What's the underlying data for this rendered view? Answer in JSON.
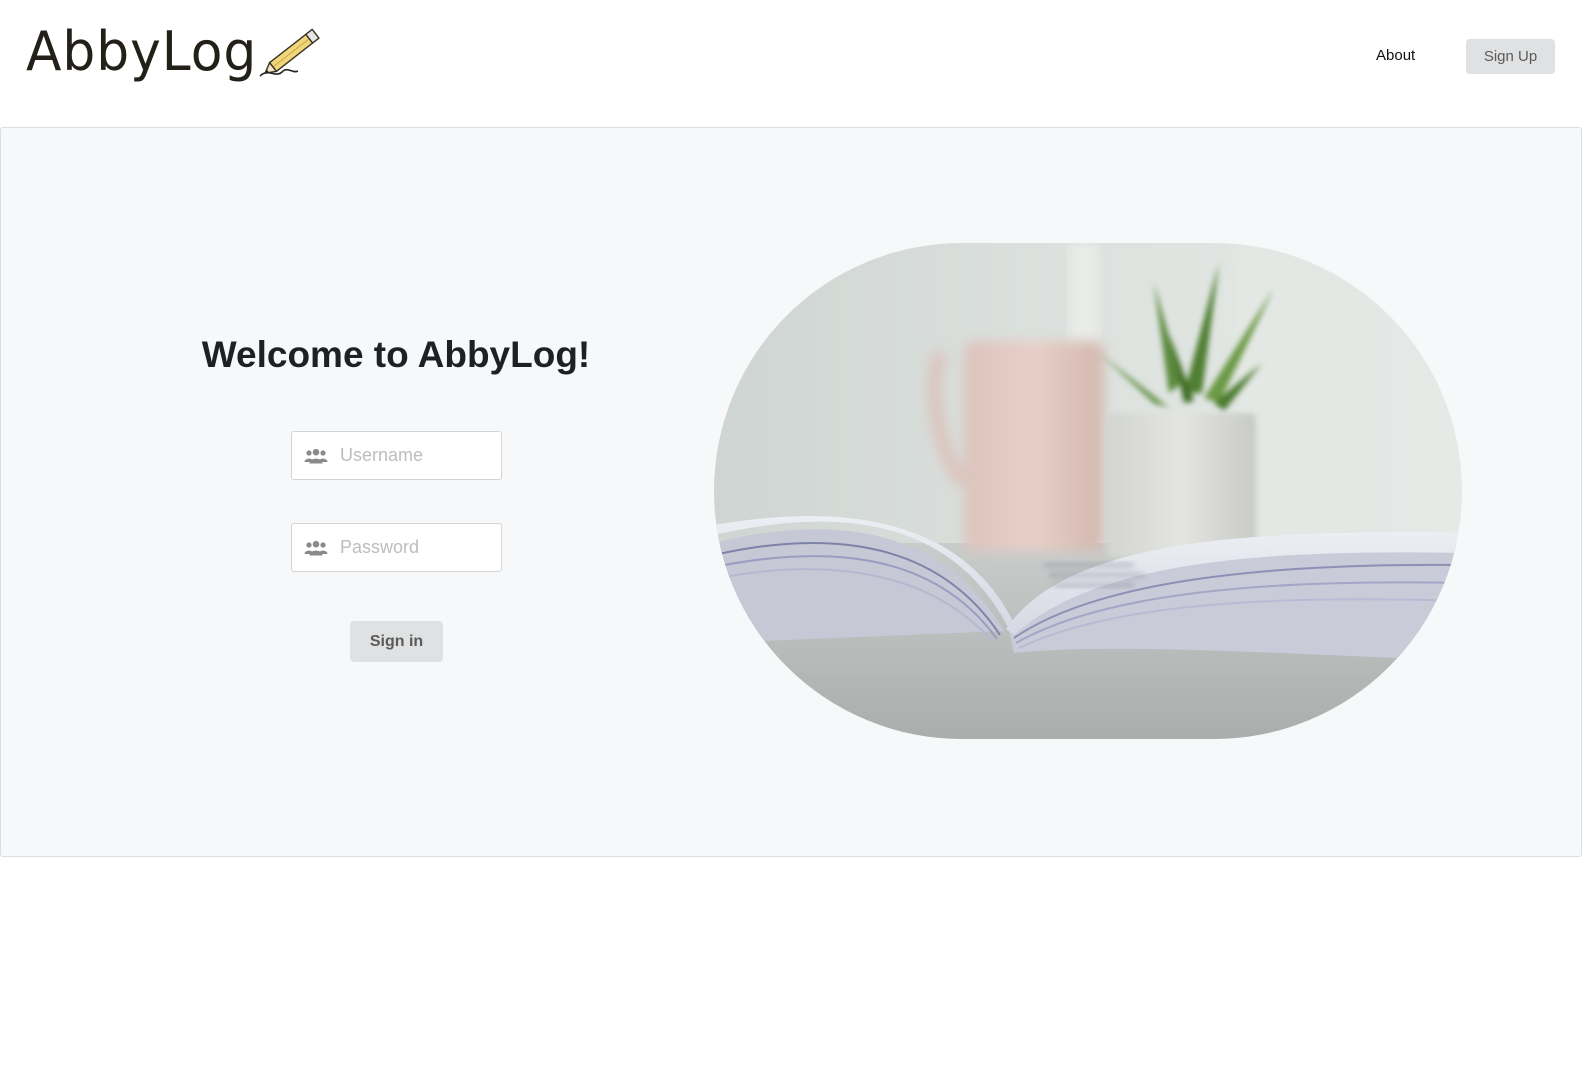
{
  "header": {
    "logo_text": "AbbyLog",
    "nav": {
      "about_label": "About",
      "signup_label": "Sign Up"
    }
  },
  "login": {
    "title": "Welcome to AbbyLog!",
    "username": {
      "placeholder": "Username",
      "value": "",
      "icon": "users-icon"
    },
    "password": {
      "placeholder": "Password",
      "value": "",
      "icon": "users-icon"
    },
    "signin_label": "Sign in"
  },
  "hero": {
    "subject": "open book, pink mug and potted plant on a table"
  },
  "colors": {
    "panel_bg": "#f7f8f9",
    "button_bg": "#e0e1e2",
    "button_text": "#5a5a5a",
    "title_text": "#1f2022"
  }
}
